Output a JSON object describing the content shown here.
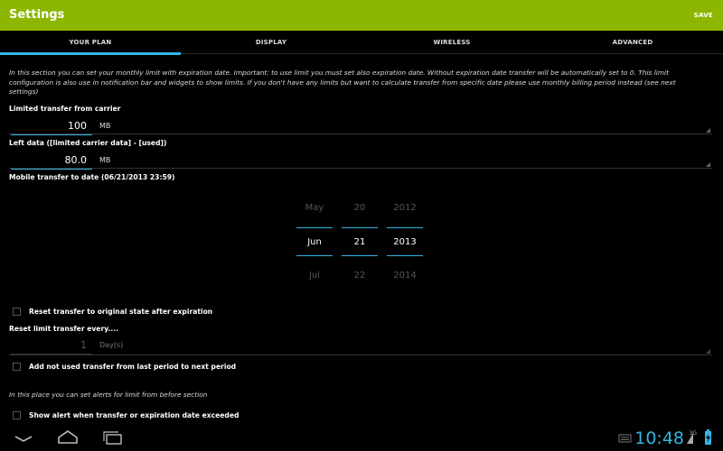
{
  "actionbar": {
    "title": "Settings",
    "save_label": "SAVE"
  },
  "tabs": [
    {
      "label": "YOUR PLAN",
      "selected": true
    },
    {
      "label": "DISPLAY",
      "selected": false
    },
    {
      "label": "WIRELESS",
      "selected": false
    },
    {
      "label": "ADVANCED",
      "selected": false
    }
  ],
  "intro": "In this section you can set your monthly limit with expiration date. Important: to use limit you must set also expiration date. Without expiration date transfer will be automatically set to 0. This limit configuration is also use in notification bar and widgets to show limits. If you don't have any limits but want to calculate transfer from specific date please use monthly billing period instead (see next settings)",
  "limited": {
    "label": "Limited transfer from carrier",
    "value": "100",
    "unit": "MB"
  },
  "left": {
    "label": "Left data ([limited carrier data] - [used])",
    "value": "80.0",
    "unit": "MB"
  },
  "mobile": {
    "label": "Mobile transfer to date (06/21/2013 23:59)"
  },
  "picker": {
    "month": {
      "prev": "May",
      "current": "Jun",
      "next": "Jul"
    },
    "day": {
      "prev": "20",
      "current": "21",
      "next": "22"
    },
    "year": {
      "prev": "2012",
      "current": "2013",
      "next": "2014"
    }
  },
  "reset_checkbox": {
    "label": "Reset transfer to original state after expiration",
    "checked": false
  },
  "reset_every": {
    "label": "Reset limit transfer every....",
    "value": "1",
    "unit": "Day(s)"
  },
  "add_unused_checkbox": {
    "label": "Add not used transfer from last period to next period",
    "checked": false
  },
  "alerts_hint": "In this place you can set alerts for limit from before section",
  "show_alert_checkbox": {
    "label": "Show alert when transfer or expiration date exceeded",
    "checked": false
  },
  "statusbar": {
    "time": "10:48",
    "network": "3G"
  },
  "colors": {
    "accent": "#33b5e5",
    "actionbar": "#8db600",
    "background": "#000000"
  }
}
